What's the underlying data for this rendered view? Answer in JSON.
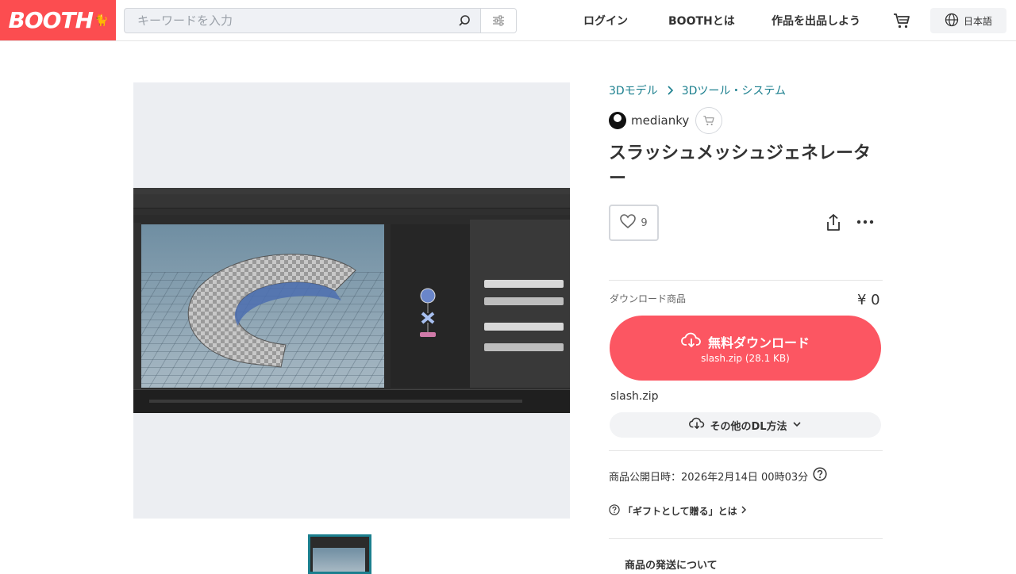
{
  "header": {
    "logo": "BOOTH",
    "search_placeholder": "キーワードを入力",
    "nav": {
      "login": "ログイン",
      "about": "BOOTHとは",
      "sell": "作品を出品しよう"
    },
    "language": "日本語"
  },
  "breadcrumb": [
    "3Dモデル",
    "3Dツール・システム"
  ],
  "shop": {
    "name": "medianky"
  },
  "product": {
    "title": "スラッシュメッシュジェネレーター",
    "likes": "9",
    "download_label": "ダウンロード商品",
    "price": "¥ 0",
    "download_button": "無料ダウンロード",
    "download_file": "slash.zip (28.1 KB)",
    "filename": "slash.zip",
    "other_dl": "その他のDL方法",
    "published": "商品公開日時：2026年2月14日 00時03分",
    "gift": "「ギフトとして贈る」とは",
    "shipping": "商品の発送について"
  },
  "colors": {
    "brand": "#fc4d50",
    "download": "#fc5662",
    "link": "#1b7f8e"
  }
}
